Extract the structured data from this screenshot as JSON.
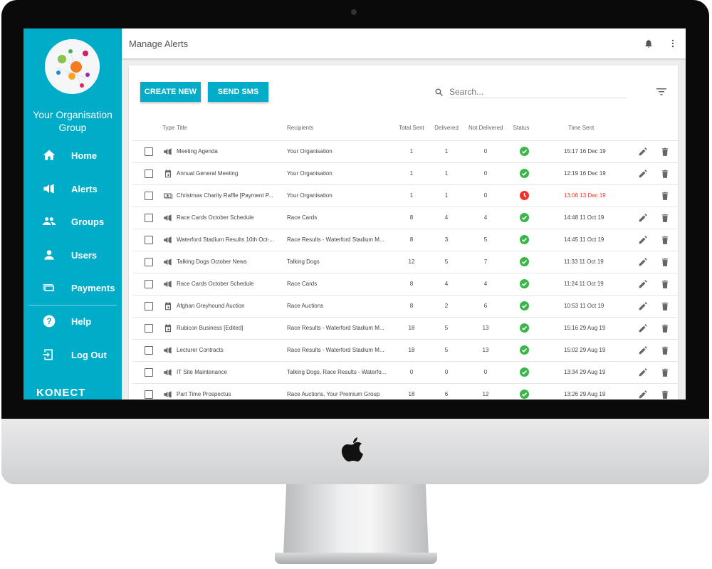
{
  "sidebar": {
    "org_name": "Your Organisation Group",
    "brand": "KONECT",
    "items": [
      {
        "label": "Home",
        "icon": "home-icon"
      },
      {
        "label": "Alerts",
        "icon": "megaphone-icon"
      },
      {
        "label": "Groups",
        "icon": "groups-icon"
      },
      {
        "label": "Users",
        "icon": "user-icon"
      },
      {
        "label": "Payments",
        "icon": "payments-icon"
      },
      {
        "label": "Help",
        "icon": "help-icon"
      },
      {
        "label": "Log Out",
        "icon": "logout-icon"
      }
    ]
  },
  "header": {
    "title": "Manage Alerts"
  },
  "toolbar": {
    "create_label": "CREATE NEW",
    "sms_label": "SEND SMS",
    "search_placeholder": "Search..."
  },
  "colors": {
    "accent": "#00acc8",
    "ok": "#3bb54a",
    "error": "#f0342c"
  },
  "table": {
    "headers": {
      "type": "Type",
      "title": "Title",
      "recipients": "Recipients",
      "total": "Total Sent",
      "delivered": "Delivered",
      "not_delivered": "Not Delivered",
      "status": "Status",
      "time": "Time Sent"
    },
    "rows": [
      {
        "type": "megaphone",
        "title": "Meeting Agenda",
        "recipients": "Your Organisation",
        "total": "1",
        "delivered": "1",
        "not_delivered": "0",
        "status": "sent",
        "time": "15:17 16 Dec 19",
        "editable": true
      },
      {
        "type": "calendar",
        "title": "Annual General Meeting",
        "recipients": "Your Organisation",
        "total": "1",
        "delivered": "1",
        "not_delivered": "0",
        "status": "sent",
        "time": "12:19 16 Dec 19",
        "editable": true
      },
      {
        "type": "payment",
        "title": "Christmas Charity Raffle [Payment P...",
        "recipients": "Your Organisation",
        "total": "1",
        "delivered": "1",
        "not_delivered": "0",
        "status": "expired",
        "time": "13:06 13 Dec 19",
        "editable": false
      },
      {
        "type": "megaphone",
        "title": "Race Cards October Schedule",
        "recipients": "Race Cards",
        "total": "8",
        "delivered": "4",
        "not_delivered": "4",
        "status": "sent",
        "time": "14:48 11 Oct 19",
        "editable": true
      },
      {
        "type": "megaphone",
        "title": "Waterford Stadium Results 10th Oct-...",
        "recipients": "Race Results - Waterford Stadium M...",
        "total": "8",
        "delivered": "3",
        "not_delivered": "5",
        "status": "sent",
        "time": "14:45 11 Oct 19",
        "editable": true
      },
      {
        "type": "megaphone",
        "title": "Talking Dogs October News",
        "recipients": "Talking Dogs",
        "total": "12",
        "delivered": "5",
        "not_delivered": "7",
        "status": "sent",
        "time": "11:33 11 Oct 19",
        "editable": true
      },
      {
        "type": "megaphone",
        "title": "Race Cards October Schedule",
        "recipients": "Race Cards",
        "total": "8",
        "delivered": "4",
        "not_delivered": "4",
        "status": "sent",
        "time": "11:24 11 Oct 19",
        "editable": true
      },
      {
        "type": "calendar",
        "title": "Afghan Greyhound Auction",
        "recipients": "Race Auctions",
        "total": "8",
        "delivered": "2",
        "not_delivered": "6",
        "status": "sent",
        "time": "10:53 11 Oct 19",
        "editable": true
      },
      {
        "type": "calendar",
        "title": "Rubicon Business [Edited]",
        "recipients": "Race Results - Waterford Stadium M...",
        "total": "18",
        "delivered": "5",
        "not_delivered": "13",
        "status": "sent",
        "time": "15:16 29 Aug 19",
        "editable": true
      },
      {
        "type": "megaphone",
        "title": "Lecturer Contracts",
        "recipients": "Race Results - Waterford Stadium M...",
        "total": "18",
        "delivered": "5",
        "not_delivered": "13",
        "status": "sent",
        "time": "15:02 29 Aug 19",
        "editable": true
      },
      {
        "type": "megaphone",
        "title": "IT Site Maintenance",
        "recipients": "Talking Dogs, Race Results - Waterfo...",
        "total": "0",
        "delivered": "0",
        "not_delivered": "0",
        "status": "sent",
        "time": "13:34 29 Aug 19",
        "editable": true
      },
      {
        "type": "megaphone",
        "title": "Part Time Prospectus",
        "recipients": "Race Auctions, Your Premium Group",
        "total": "18",
        "delivered": "6",
        "not_delivered": "12",
        "status": "sent",
        "time": "13:26 29 Aug 19",
        "editable": true
      }
    ]
  }
}
